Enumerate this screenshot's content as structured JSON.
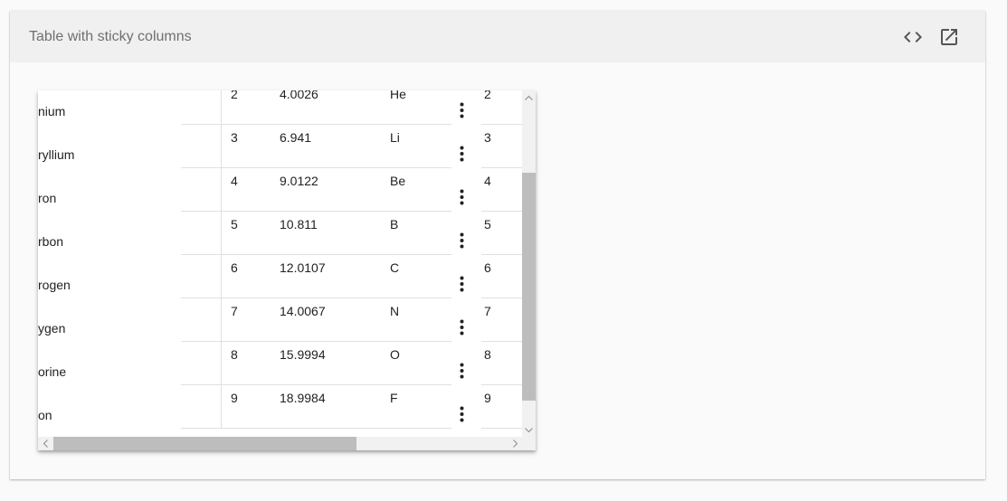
{
  "card": {
    "title": "Table with sticky columns",
    "code_icon": "code-icon",
    "open_icon": "open-in-new-icon"
  },
  "table": {
    "rows": [
      {
        "name": "nium",
        "position": "2",
        "weight": "4.0026",
        "symbol": "He",
        "position_end": "2"
      },
      {
        "name": "ryllium",
        "position": "3",
        "weight": "6.941",
        "symbol": "Li",
        "position_end": "3"
      },
      {
        "name": "ron",
        "position": "4",
        "weight": "9.0122",
        "symbol": "Be",
        "position_end": "4"
      },
      {
        "name": "rbon",
        "position": "5",
        "weight": "10.811",
        "symbol": "B",
        "position_end": "5"
      },
      {
        "name": "rogen",
        "position": "6",
        "weight": "12.0107",
        "symbol": "C",
        "position_end": "6"
      },
      {
        "name": "ygen",
        "position": "7",
        "weight": "14.0067",
        "symbol": "N",
        "position_end": "7"
      },
      {
        "name": "orine",
        "position": "8",
        "weight": "15.9994",
        "symbol": "O",
        "position_end": "8"
      },
      {
        "name": "on",
        "position": "9",
        "weight": "18.9984",
        "symbol": "F",
        "position_end": "9"
      }
    ],
    "row_menu_icon": "more-vert-icon"
  },
  "colors": {
    "header_bg": "#f0f0f0",
    "title_text": "#6f6f6f",
    "scroll_thumb": "#bdbdbd",
    "scroll_track": "#f1f1f1",
    "divider": "#e0e0e0"
  }
}
